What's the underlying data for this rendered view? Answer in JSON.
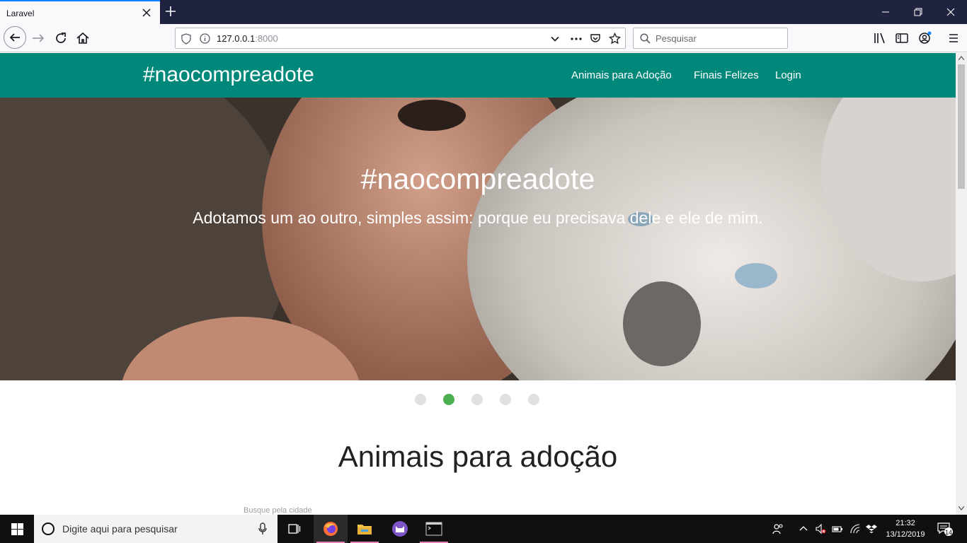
{
  "browser": {
    "tab_title": "Laravel",
    "url_host": "127.0.0.1",
    "url_port": ":8000",
    "search_placeholder": "Pesquisar"
  },
  "site": {
    "brand": "#naocompreadote",
    "nav": [
      "Animais para Adoção",
      "Finais Felizes",
      "Login"
    ]
  },
  "hero": {
    "title": "#naocompreadote",
    "subtitle": "Adotamos um ao outro, simples assim: porque eu precisava dele e ele de mim.",
    "slide_count": 5,
    "active_slide": 2
  },
  "section": {
    "title": "Animais para adoção",
    "city_label": "Busque pela cidade"
  },
  "taskbar": {
    "search_placeholder": "Digite aqui para pesquisar",
    "time": "21:32",
    "date": "13/12/2019",
    "notification_count": "14"
  },
  "colors": {
    "header": "#00897b",
    "dot_active": "#4caf50",
    "dot_inactive": "#e0e0e0",
    "tabstrip": "#202340"
  }
}
